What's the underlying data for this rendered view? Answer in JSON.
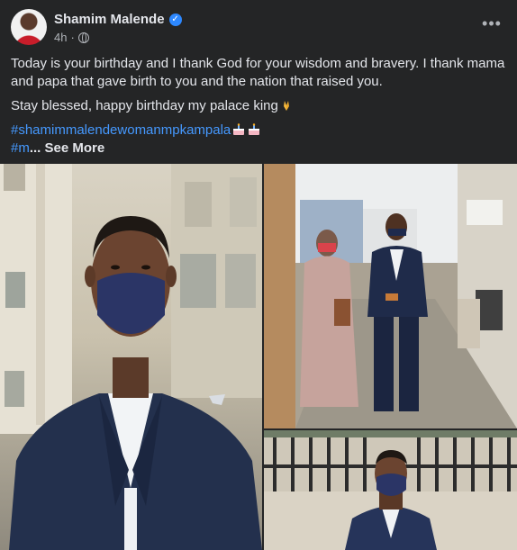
{
  "post": {
    "author": "Shamim Malende",
    "time": "4h",
    "more_label": "•••",
    "paragraph1": "Today is your birthday and I thank God for your wisdom and bravery. I thank mama and papa that gave birth to you and the nation that raised you.",
    "paragraph2": "Stay blessed, happy birthday my palace king",
    "hashtag1": "#shamimmalendewomanmpkampala",
    "hashtag2": "#m",
    "see_more": "... See More"
  },
  "icons": {
    "verified": "verified-badge-icon",
    "privacy": "globe-icon",
    "pray": "folded-hands-emoji",
    "cake": "birthday-cake-emoji"
  },
  "colors": {
    "background": "#242526",
    "text": "#e4e6eb",
    "secondary": "#b0b3b8",
    "link": "#4599ff",
    "verified": "#2d88ff"
  }
}
